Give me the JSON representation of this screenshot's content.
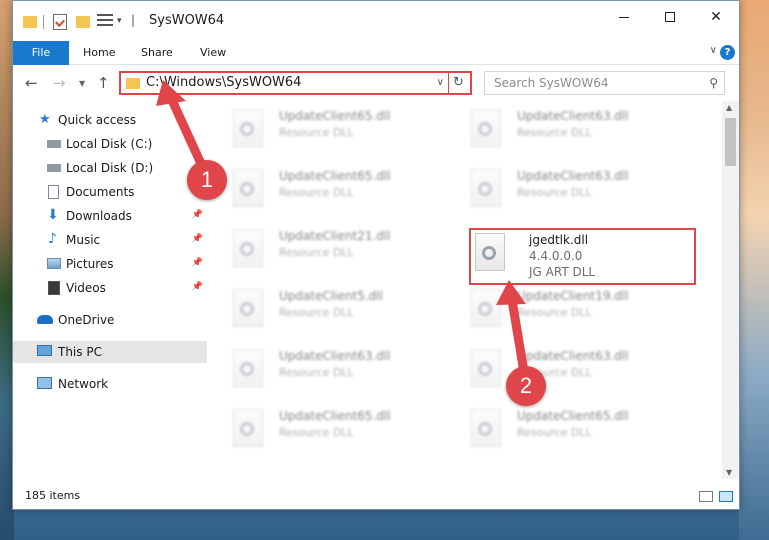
{
  "window": {
    "title": "SysWOW64"
  },
  "ribbon": {
    "tabs": [
      "File",
      "Home",
      "Share",
      "View"
    ],
    "help_label": "?"
  },
  "address": {
    "path": "C:\\Windows\\SysWOW64",
    "search_placeholder": "Search SysWOW64"
  },
  "nav": {
    "items": [
      {
        "label": "Quick access",
        "icon": "star-icon"
      },
      {
        "label": "Local Disk (C:)",
        "icon": "drive-icon"
      },
      {
        "label": "Local Disk (D:)",
        "icon": "drive-icon"
      },
      {
        "label": "Documents",
        "icon": "documents-icon"
      },
      {
        "label": "Downloads",
        "icon": "download-icon"
      },
      {
        "label": "Music",
        "icon": "music-icon"
      },
      {
        "label": "Pictures",
        "icon": "pictures-icon"
      },
      {
        "label": "Videos",
        "icon": "videos-icon"
      },
      {
        "label": "OneDrive",
        "icon": "cloud-icon"
      },
      {
        "label": "This PC",
        "icon": "computer-icon"
      },
      {
        "label": "Network",
        "icon": "network-icon"
      }
    ]
  },
  "files": {
    "left_column": [
      {
        "name": "UpdateClient65.dll",
        "desc": "Resource DLL"
      },
      {
        "name": "UpdateClient65.dll",
        "desc": "Resource DLL"
      },
      {
        "name": "UpdateClient21.dll",
        "desc": "Resource DLL"
      },
      {
        "name": "UpdateClient5.dll",
        "desc": "Resource DLL"
      },
      {
        "name": "UpdateClient63.dll",
        "desc": "Resource DLL"
      },
      {
        "name": "UpdateClient65.dll",
        "desc": "Resource DLL"
      }
    ],
    "right_column": [
      {
        "name": "UpdateClient63.dll",
        "desc": "Resource DLL"
      },
      {
        "name": "UpdateClient63.dll",
        "desc": "Resource DLL"
      },
      {
        "name": "UpdateClient19.dll",
        "desc": "Resource DLL"
      },
      {
        "name": "UpdateClient63.dll",
        "desc": "Resource DLL"
      },
      {
        "name": "UpdateClient65.dll",
        "desc": "Resource DLL"
      }
    ],
    "highlighted": {
      "name": "jgedtlk.dll",
      "version": "4.4.0.0.0",
      "desc": "JG ART DLL"
    }
  },
  "status": {
    "count": "185 items"
  },
  "annotations": {
    "step1": "1",
    "step2": "2"
  },
  "colors": {
    "accent": "#1979ca",
    "annotation": "#e0454a"
  }
}
